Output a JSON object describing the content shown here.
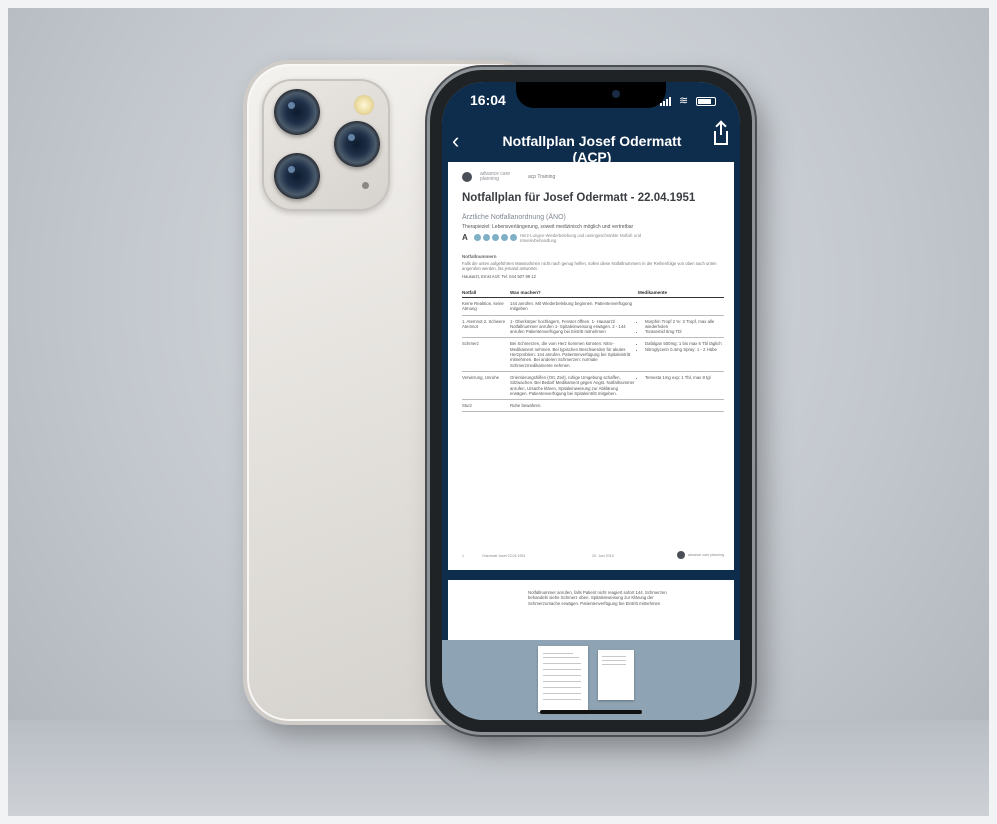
{
  "status_bar": {
    "time": "16:04"
  },
  "nav": {
    "title": "Notfallplan Josef Odermatt (ACP)"
  },
  "document": {
    "logo_text": "advance care planning",
    "logo_subtitle": "acp Training",
    "title": "Notfallplan für Josef Odermatt - 22.04.1951",
    "section_title": "Ärztliche Notfallanordnung (ÄNO)",
    "section_subtitle": "Therapieziel: Lebensverlängerung, soweit medizinisch möglich und vertretbar",
    "grade": "A",
    "grade_note": "Herz-Lungen-Wiederbelebung und uneingeschränkte Notfall- und Intensivbehandlung",
    "notfall_head": "Notfallnummern",
    "notfall_text": "Falls die unten aufgeführten Massnahmen nicht nach genug helfen, sollen diese Notfallnummern in der Reihenfolge von oben nach unten angerufen werden, bis jemand antwortet.",
    "notfall_contact": "Hausarzt, Ernst Arzt: Tel. 044 507 89 12",
    "table": {
      "headers": [
        "Notfall",
        "Was machen?",
        "Medikamente"
      ],
      "rows": [
        {
          "notfall": "Keine Reaktion, keine Atmung",
          "was": "144 anrufen. Mit Wiederbelebung beginnen. Patientenverfügung mitgeben",
          "meds": []
        },
        {
          "notfall": "1. Atemnot 2. Schwere Atemnot",
          "was": "1- Oberkörper hochlagern, Fenster öffnen. 1- Hausarzt/ Notfallnummer anrufen 1- Spitaleinweisung erwägen. 2 - 144 anrufen Patientenverfügung bei Eintritt mitnehmen",
          "meds": [
            "Morphin Tropf 2 %: 3 Tropf, max alle wiederholen",
            "Torasemid 5mg Tbl"
          ]
        },
        {
          "notfall": "Schmerz",
          "was": "Bei Schmerzen, die vom Herz kommen könnten: Nitro-Medikament nehmen. Bei typischen Beschwerden für akutes Herzproblem: 144 anrufen. Patientenverfügung bei Spitaleintritt mitnehmen. Bei anderen Schmerzen: normale Schmerzmedikamente nehmen.",
          "meds": [
            "Dafalgan 500mg: 1 bis max 6 Tbl täglich",
            "Nitroglycerin 0.4mg Spray: 1 - 2 Hübe"
          ]
        },
        {
          "notfall": "Verwirrung, Unruhe",
          "was": "Orientierungshilfen (Ort, Zeit), ruhige Umgebung schaffen, Sitzwachen. Bei Bedarf Medikament gegen Angst. Notfallnummer anrufen, Ursache klären, Spitaleinweisung zur Abklärung erwägen. Patientenverfügung bei Spitaleintritt mitgeben.",
          "meds": [
            "Temesta 1mg exp: 1 Tbl, max 8 tgl"
          ]
        },
        {
          "notfall": "Sturz",
          "was": "Ruhe bewahren.",
          "meds": []
        }
      ]
    },
    "footer": {
      "page": "1",
      "name": "Odermatt Josef 22.04.1951",
      "date": "20. Juni 2019"
    },
    "page2_text": "Notfallnummer anrufen, falls Patient nicht reagiert sofort 144. Schmerzen behandeln siehe Schmerz oben. Spitaleinweisung zur Klärung der Schmerzursache erwägen. Patientenverfügung bei Eintritt mitnehmen"
  }
}
